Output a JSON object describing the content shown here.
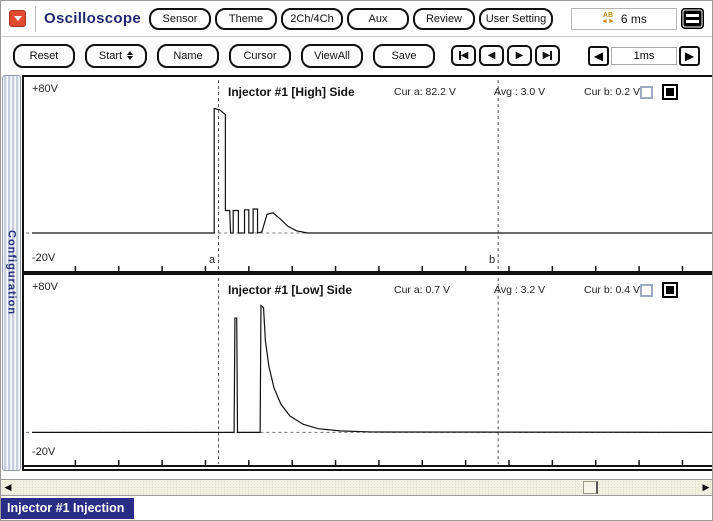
{
  "titlebar": {
    "app_title": "Oscilloscope",
    "buttons": [
      "Sensor",
      "Theme",
      "2Ch/4Ch",
      "Aux",
      "Review",
      "User Setting"
    ],
    "ab_icon_line1": "AB",
    "ab_icon_line2": "◄►",
    "ab_readout": "6 ms"
  },
  "toolbar": {
    "buttons": [
      "Reset",
      "Start",
      "Name",
      "Cursor",
      "ViewAll",
      "Save"
    ],
    "timebase_value": "1ms"
  },
  "icons": {
    "playback_prev": "◀",
    "playback_next": "▶",
    "timebase_left": "◀",
    "timebase_right": "▶",
    "scroll_left": "◀",
    "scroll_right": "▶"
  },
  "sidebar": {
    "tab_label": "Configuration"
  },
  "status_bar": {
    "label": "Injector #1 Injection"
  },
  "colors": {
    "accent_navy": "#2a2d85",
    "red_menu_icon": "#e2492f",
    "ab_gold": "#c09018",
    "scroll_track": "#f2f0e1",
    "trace": "#111111"
  },
  "chart_data": [
    {
      "type": "line",
      "title": "Injector #1 [High] Side",
      "readouts": {
        "cur_a": "Cur a: 82.2 V",
        "avg": "Avg : 3.0 V",
        "cur_b": "Cur b: 0.2 V"
      },
      "y_top_label": "+80V",
      "y_bottom_label": "-20V",
      "cursor_a_label": "a",
      "cursor_b_label": "b",
      "ylim": [
        -20,
        80
      ],
      "x_span_ms": 15.7,
      "ms_per_div": 1,
      "grid": "dashed-zero-line",
      "cursor_a_ms": 4.3,
      "cursor_b_ms": 10.75,
      "series": [
        {
          "name": "high-side-voltage",
          "points_ms_v": [
            [
              0,
              0
            ],
            [
              4.2,
              0
            ],
            [
              4.2,
              83
            ],
            [
              4.32,
              82.2
            ],
            [
              4.46,
              79
            ],
            [
              4.46,
              15
            ],
            [
              4.56,
              15
            ],
            [
              4.58,
              0
            ],
            [
              4.64,
              0
            ],
            [
              4.64,
              15
            ],
            [
              4.76,
              15
            ],
            [
              4.76,
              0
            ],
            [
              4.9,
              0
            ],
            [
              4.9,
              15.5
            ],
            [
              5.0,
              15.5
            ],
            [
              5.0,
              0
            ],
            [
              5.1,
              0
            ],
            [
              5.1,
              16
            ],
            [
              5.2,
              16
            ],
            [
              5.2,
              0
            ],
            [
              5.3,
              0.7
            ],
            [
              5.42,
              12.5
            ],
            [
              5.56,
              13.5
            ],
            [
              5.72,
              9.5
            ],
            [
              5.9,
              4.5
            ],
            [
              6.1,
              1.5
            ],
            [
              6.35,
              0
            ],
            [
              15.7,
              0
            ]
          ]
        }
      ]
    },
    {
      "type": "line",
      "title": "Injector #1 [Low] Side",
      "readouts": {
        "cur_a": "Cur a: 0.7 V",
        "avg": "Avg : 3.2 V",
        "cur_b": "Cur b: 0.4 V"
      },
      "y_top_label": "+80V",
      "y_bottom_label": "-20V",
      "ylim": [
        -20,
        80
      ],
      "x_span_ms": 15.7,
      "ms_per_div": 1,
      "grid": "dashed-zero-line",
      "cursor_a_ms": 4.3,
      "cursor_b_ms": 10.75,
      "series": [
        {
          "name": "low-side-voltage",
          "points_ms_v": [
            [
              0,
              0
            ],
            [
              4.66,
              0
            ],
            [
              4.68,
              77
            ],
            [
              4.72,
              77
            ],
            [
              4.74,
              0
            ],
            [
              5.26,
              0
            ],
            [
              5.28,
              85.5
            ],
            [
              5.34,
              84
            ],
            [
              5.38,
              62
            ],
            [
              5.46,
              45
            ],
            [
              5.58,
              30
            ],
            [
              5.74,
              19
            ],
            [
              5.95,
              11
            ],
            [
              6.25,
              5.5
            ],
            [
              6.6,
              2.5
            ],
            [
              7.1,
              1
            ],
            [
              7.8,
              0.3
            ],
            [
              15.7,
              0
            ]
          ]
        }
      ]
    }
  ]
}
